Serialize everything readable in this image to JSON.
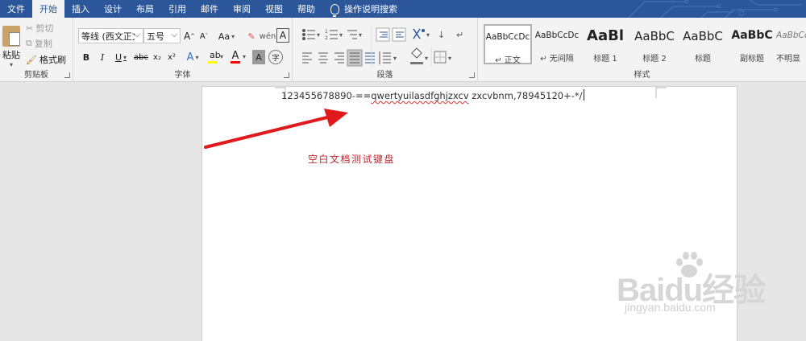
{
  "menu": {
    "tabs": [
      "文件",
      "开始",
      "插入",
      "设计",
      "布局",
      "引用",
      "邮件",
      "审阅",
      "视图",
      "帮助"
    ],
    "active_tab": "开始",
    "tell_me": "操作说明搜索"
  },
  "clipboard": {
    "paste": "粘贴",
    "cut": "剪切",
    "copy": "复制",
    "format_painter": "格式刷",
    "group_label": "剪贴板"
  },
  "font": {
    "name": "等线 (西文正文",
    "size": "五号",
    "grow": "A",
    "shrink": "A",
    "case": "Aa",
    "bold": "B",
    "italic": "I",
    "underline": "U",
    "strike": "abc",
    "subscript": "x₂",
    "superscript": "x²",
    "effects": "A",
    "color_letter": "A",
    "group_label": "字体",
    "highlight_color": "#ffff00",
    "font_color": "#ff0000"
  },
  "paragraph": {
    "group_label": "段落"
  },
  "styles": {
    "group_label": "样式",
    "items": [
      {
        "sample": "AaBbCcDc",
        "name": "正文"
      },
      {
        "sample": "AaBbCcDc",
        "name": "无间隔"
      },
      {
        "sample": "AaBl",
        "name": "标题 1"
      },
      {
        "sample": "AaBbC",
        "name": "标题 2"
      },
      {
        "sample": "AaBbC",
        "name": "标题"
      },
      {
        "sample": "AaBbC",
        "name": "副标题"
      },
      {
        "sample": "AaBbCcI",
        "name": "不明显"
      }
    ]
  },
  "document": {
    "line_prefix": "123455678890-==",
    "line_misspelled": "qwertyuilasdfghjzxcv",
    "line_suffix": " zxcvbnm,78945120+-*/",
    "annotation": "空白文档测试键盘"
  },
  "watermark": {
    "brand": "Baidu经验",
    "url": "jingyan.baidu.com"
  },
  "colors": {
    "accent": "#2b579a",
    "arrow": "#e0191d",
    "annotation": "#c0272d"
  }
}
